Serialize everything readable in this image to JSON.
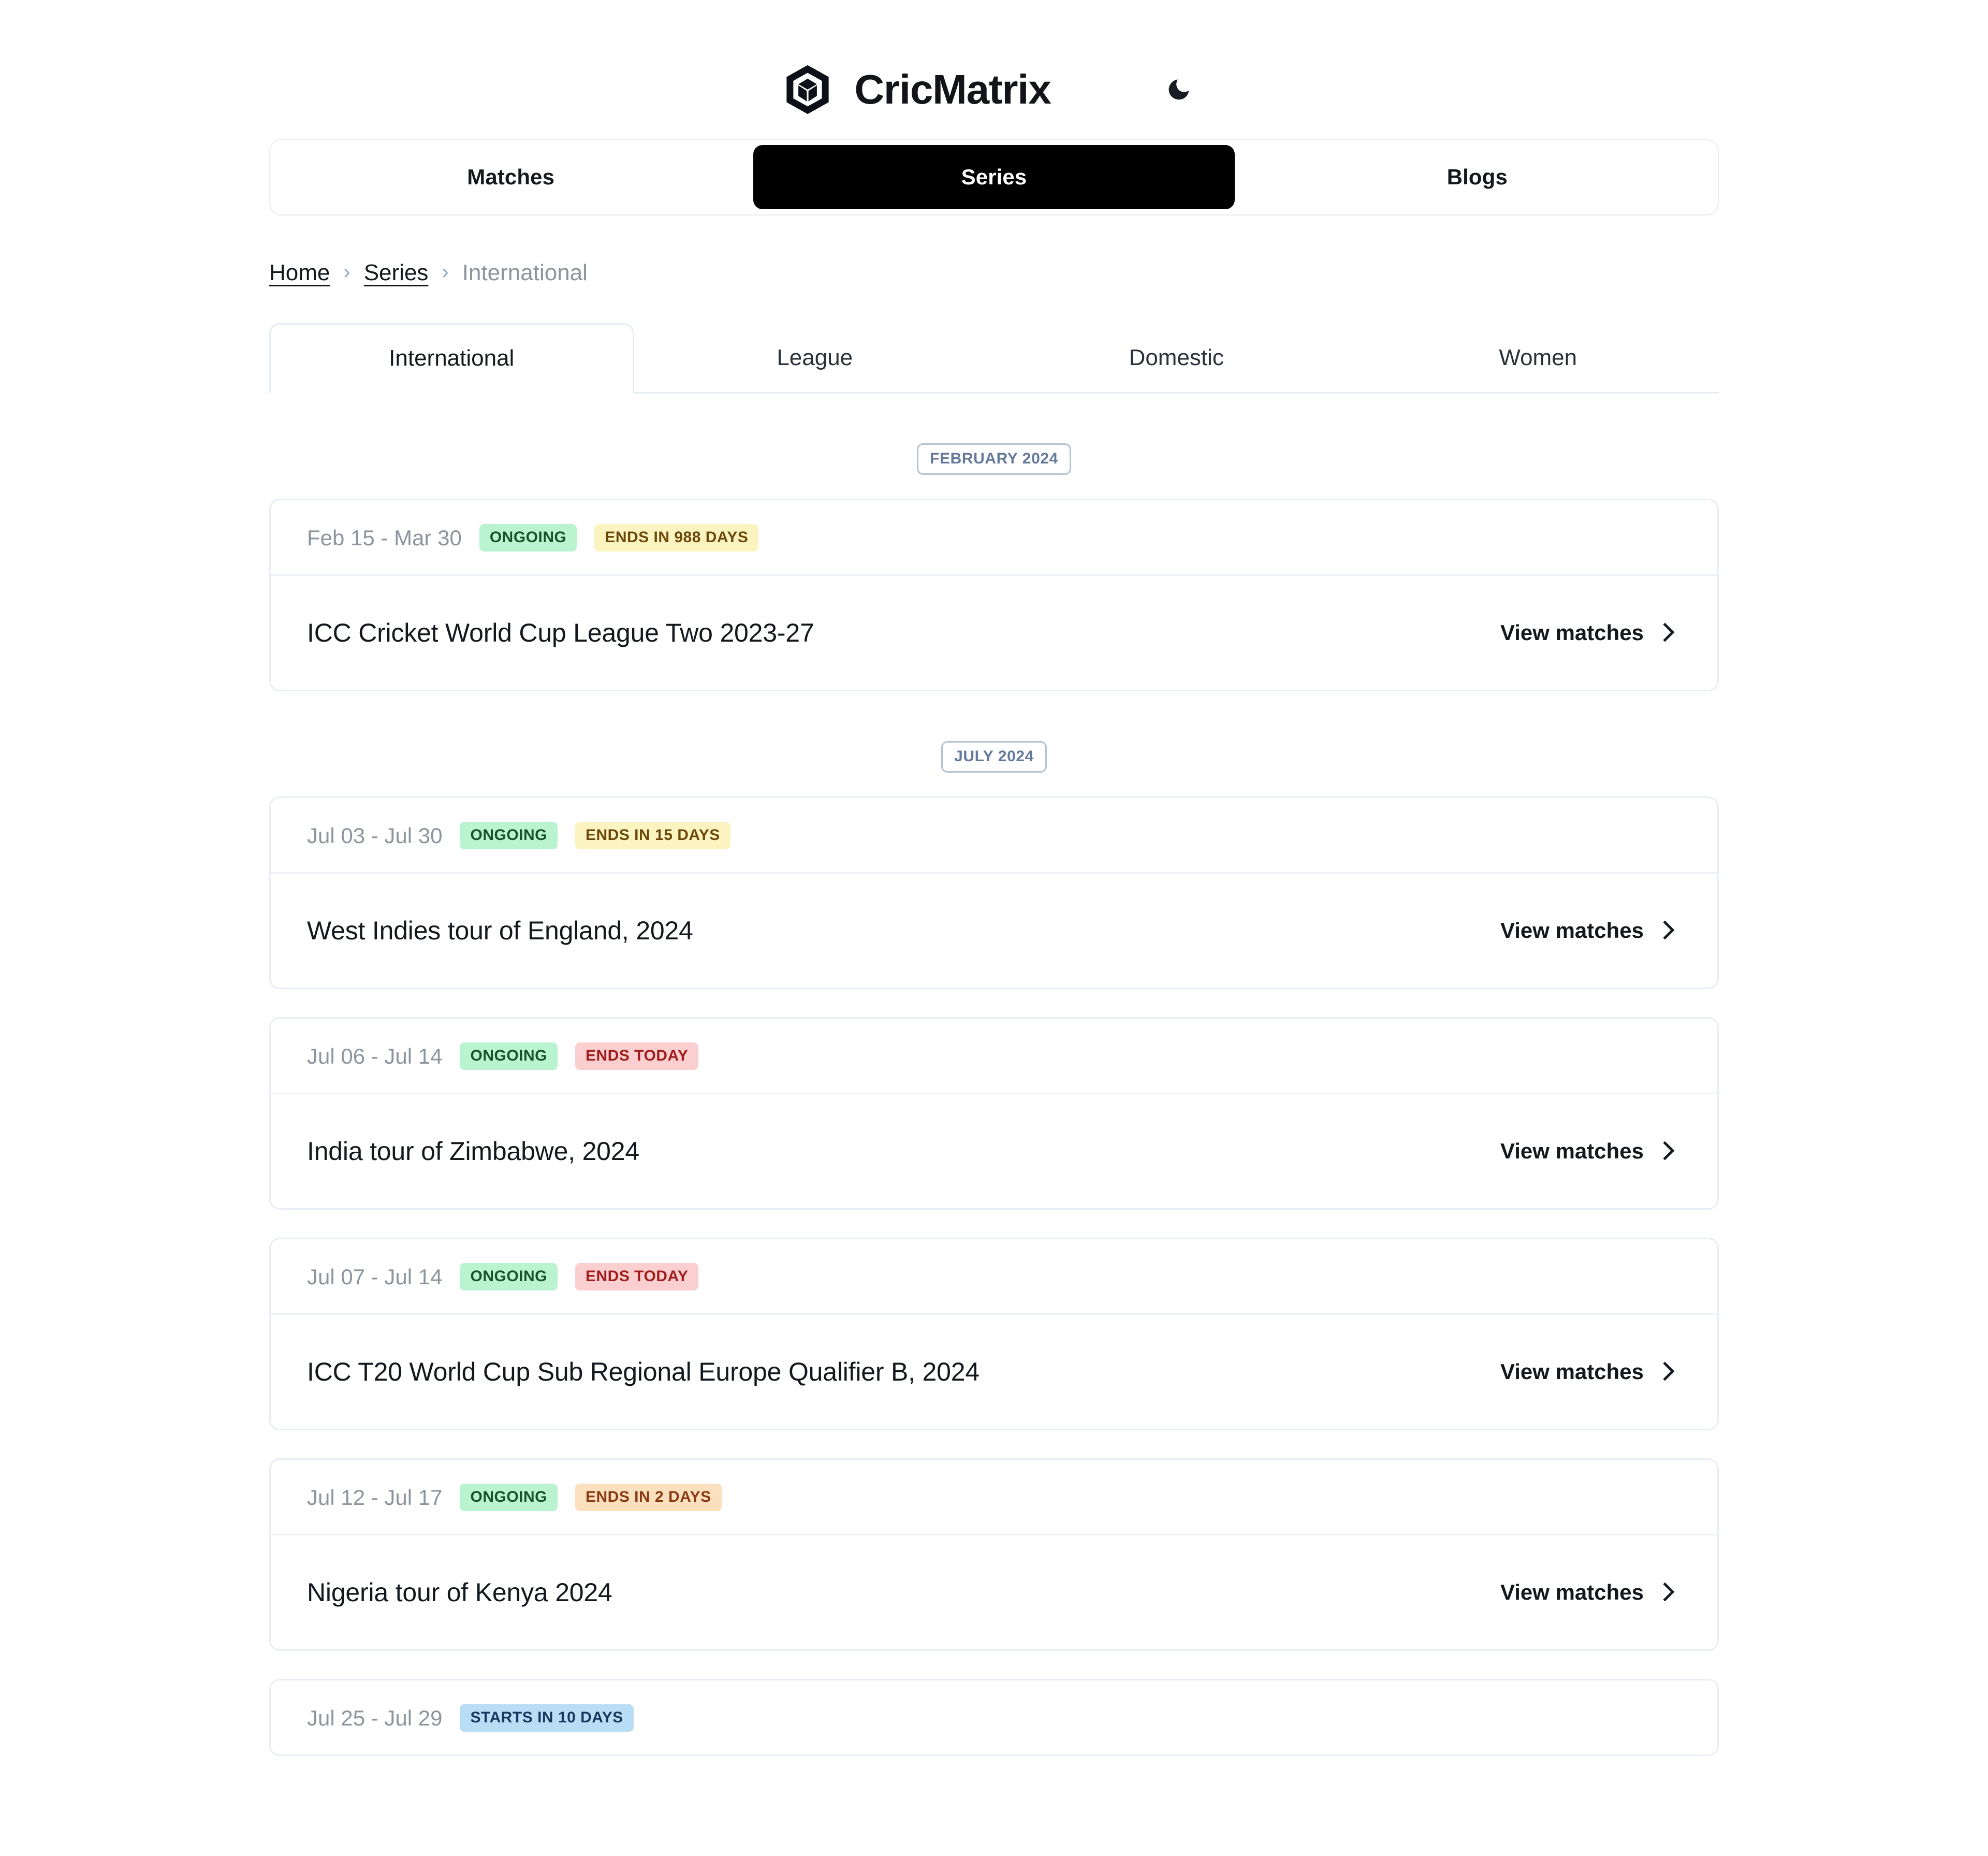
{
  "header": {
    "brand_name": "CricMatrix",
    "logo_icon": "cube-logo-icon",
    "theme_toggle_icon": "moon-icon"
  },
  "primary_nav": {
    "items": [
      {
        "label": "Matches",
        "active": false
      },
      {
        "label": "Series",
        "active": true
      },
      {
        "label": "Blogs",
        "active": false
      }
    ]
  },
  "breadcrumb": {
    "separator": "›",
    "items": [
      {
        "label": "Home",
        "current": false
      },
      {
        "label": "Series",
        "current": false
      },
      {
        "label": "International",
        "current": true
      }
    ]
  },
  "category_tabs": {
    "items": [
      {
        "label": "International",
        "active": true
      },
      {
        "label": "League",
        "active": false
      },
      {
        "label": "Domestic",
        "active": false
      },
      {
        "label": "Women",
        "active": false
      }
    ]
  },
  "view_matches_label": "View matches",
  "groups": [
    {
      "month_label": "FEBRUARY 2024",
      "cards": [
        {
          "dates": "Feb 15 - Mar 30",
          "badges": [
            {
              "text": "ONGOING",
              "style": "ongoing"
            },
            {
              "text": "ENDS IN 988 DAYS",
              "style": "yellow"
            }
          ],
          "title": "ICC Cricket World Cup League Two 2023-27",
          "partial": false
        }
      ]
    },
    {
      "month_label": "JULY 2024",
      "cards": [
        {
          "dates": "Jul 03 - Jul 30",
          "badges": [
            {
              "text": "ONGOING",
              "style": "ongoing"
            },
            {
              "text": "ENDS IN 15 DAYS",
              "style": "yellow"
            }
          ],
          "title": "West Indies tour of England, 2024",
          "partial": false
        },
        {
          "dates": "Jul 06 - Jul 14",
          "badges": [
            {
              "text": "ONGOING",
              "style": "ongoing"
            },
            {
              "text": "ENDS TODAY",
              "style": "red"
            }
          ],
          "title": "India tour of Zimbabwe, 2024",
          "partial": false
        },
        {
          "dates": "Jul 07 - Jul 14",
          "badges": [
            {
              "text": "ONGOING",
              "style": "ongoing"
            },
            {
              "text": "ENDS TODAY",
              "style": "red"
            }
          ],
          "title": "ICC T20 World Cup Sub Regional Europe Qualifier B, 2024",
          "partial": false
        },
        {
          "dates": "Jul 12 - Jul 17",
          "badges": [
            {
              "text": "ONGOING",
              "style": "ongoing"
            },
            {
              "text": "ENDS IN 2 DAYS",
              "style": "orange"
            }
          ],
          "title": "Nigeria tour of Kenya 2024",
          "partial": false
        },
        {
          "dates": "Jul 25 - Jul 29",
          "badges": [
            {
              "text": "STARTS IN 10 DAYS",
              "style": "blue"
            }
          ],
          "title": "",
          "partial": true
        }
      ]
    }
  ],
  "colors": {
    "accent_black": "#000000",
    "badge_green_bg": "#b9f3d0",
    "badge_green_text": "#14532d",
    "badge_yellow_bg": "#fbf4c0",
    "badge_yellow_text": "#6b4709",
    "badge_red_bg": "#fbcfcf",
    "badge_red_text": "#9e1c1c",
    "badge_orange_bg": "#fae0bd",
    "badge_orange_text": "#8a3a12",
    "badge_blue_bg": "#b9ddf5",
    "badge_blue_text": "#15395e",
    "month_badge_text": "#65799a",
    "muted_text": "#8d949d",
    "border": "#e8eef3"
  }
}
